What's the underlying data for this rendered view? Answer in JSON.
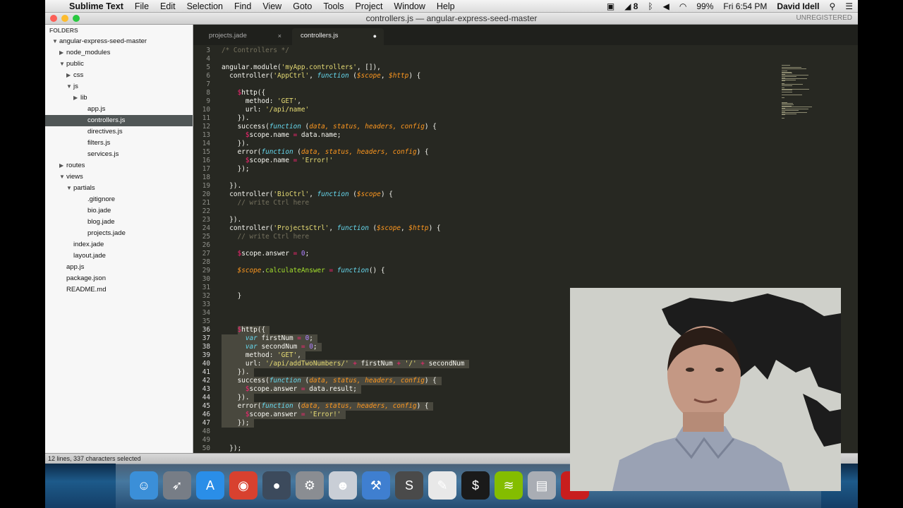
{
  "menubar": {
    "app": "Sublime Text",
    "items": [
      "File",
      "Edit",
      "Selection",
      "Find",
      "View",
      "Goto",
      "Tools",
      "Project",
      "Window",
      "Help"
    ],
    "battery": "99%",
    "clock": "Fri 6:54 PM",
    "user": "David Idell",
    "notif_count": "8"
  },
  "window": {
    "title": "controllers.js — angular-express-seed-master",
    "unregistered": "UNREGISTERED"
  },
  "sidebar": {
    "header": "FOLDERS",
    "tree": [
      {
        "label": "angular-express-seed-master",
        "depth": 0,
        "open": true
      },
      {
        "label": "node_modules",
        "depth": 1,
        "folder": true,
        "open": false
      },
      {
        "label": "public",
        "depth": 1,
        "folder": true,
        "open": true
      },
      {
        "label": "css",
        "depth": 2,
        "folder": true,
        "open": false
      },
      {
        "label": "js",
        "depth": 2,
        "folder": true,
        "open": true
      },
      {
        "label": "lib",
        "depth": 3,
        "folder": true,
        "open": false
      },
      {
        "label": "app.js",
        "depth": 3
      },
      {
        "label": "controllers.js",
        "depth": 3,
        "selected": true
      },
      {
        "label": "directives.js",
        "depth": 3
      },
      {
        "label": "filters.js",
        "depth": 3
      },
      {
        "label": "services.js",
        "depth": 3
      },
      {
        "label": "routes",
        "depth": 1,
        "folder": true,
        "open": false
      },
      {
        "label": "views",
        "depth": 1,
        "folder": true,
        "open": true
      },
      {
        "label": "partials",
        "depth": 2,
        "folder": true,
        "open": true
      },
      {
        "label": ".gitignore",
        "depth": 3
      },
      {
        "label": "bio.jade",
        "depth": 3
      },
      {
        "label": "blog.jade",
        "depth": 3
      },
      {
        "label": "projects.jade",
        "depth": 3
      },
      {
        "label": "index.jade",
        "depth": 2
      },
      {
        "label": "layout.jade",
        "depth": 2
      },
      {
        "label": "app.js",
        "depth": 1
      },
      {
        "label": "package.json",
        "depth": 1
      },
      {
        "label": "README.md",
        "depth": 1
      }
    ]
  },
  "tabs": [
    {
      "label": "projects.jade",
      "active": false,
      "close": "×"
    },
    {
      "label": "controllers.js",
      "active": true,
      "close": "●"
    }
  ],
  "code": [
    {
      "n": 3,
      "t": [
        [
          "c",
          "/* Controllers */"
        ]
      ]
    },
    {
      "n": 4,
      "t": []
    },
    {
      "n": 5,
      "t": [
        [
          "",
          "angular.module("
        ],
        [
          "s",
          "'myApp.controllers'"
        ],
        [
          "",
          ", []),"
        ]
      ]
    },
    {
      "n": 6,
      "t": [
        [
          "",
          "  controller("
        ],
        [
          "s",
          "'AppCtrl'"
        ],
        [
          "",
          ", "
        ],
        [
          "i",
          "function"
        ],
        [
          "",
          " ("
        ],
        [
          "v",
          "$scope"
        ],
        [
          "",
          ", "
        ],
        [
          "v",
          "$http"
        ],
        [
          "",
          ") {"
        ]
      ]
    },
    {
      "n": 7,
      "t": []
    },
    {
      "n": 8,
      "t": [
        [
          "",
          "    "
        ],
        [
          "k",
          "$"
        ],
        [
          "",
          "http({"
        ]
      ]
    },
    {
      "n": 9,
      "t": [
        [
          "",
          "      method: "
        ],
        [
          "s",
          "'GET'"
        ],
        [
          "",
          ","
        ]
      ]
    },
    {
      "n": 10,
      "t": [
        [
          "",
          "      url: "
        ],
        [
          "s",
          "'/api/name'"
        ]
      ]
    },
    {
      "n": 11,
      "t": [
        [
          "",
          "    })."
        ]
      ]
    },
    {
      "n": 12,
      "t": [
        [
          "",
          "    success("
        ],
        [
          "i",
          "function"
        ],
        [
          "",
          " ("
        ],
        [
          "v",
          "data, status, headers, config"
        ],
        [
          "",
          ") {"
        ]
      ]
    },
    {
      "n": 13,
      "t": [
        [
          "",
          "      "
        ],
        [
          "k",
          "$"
        ],
        [
          "",
          "scope.name "
        ],
        [
          "k",
          "="
        ],
        [
          "",
          " data.name;"
        ]
      ]
    },
    {
      "n": 14,
      "t": [
        [
          "",
          "    })."
        ]
      ]
    },
    {
      "n": 15,
      "t": [
        [
          "",
          "    error("
        ],
        [
          "i",
          "function"
        ],
        [
          "",
          " ("
        ],
        [
          "v",
          "data, status, headers, config"
        ],
        [
          "",
          ") {"
        ]
      ]
    },
    {
      "n": 16,
      "t": [
        [
          "",
          "      "
        ],
        [
          "k",
          "$"
        ],
        [
          "",
          "scope.name "
        ],
        [
          "k",
          "="
        ],
        [
          "",
          " "
        ],
        [
          "s",
          "'Error!'"
        ]
      ]
    },
    {
      "n": 17,
      "t": [
        [
          "",
          "    });"
        ]
      ]
    },
    {
      "n": 18,
      "t": []
    },
    {
      "n": 19,
      "t": [
        [
          "",
          "  })."
        ]
      ]
    },
    {
      "n": 20,
      "t": [
        [
          "",
          "  controller("
        ],
        [
          "s",
          "'BioCtrl'"
        ],
        [
          "",
          ", "
        ],
        [
          "i",
          "function"
        ],
        [
          "",
          " ("
        ],
        [
          "v",
          "$scope"
        ],
        [
          "",
          ") {"
        ]
      ]
    },
    {
      "n": 21,
      "t": [
        [
          "c",
          "    // write Ctrl here"
        ]
      ]
    },
    {
      "n": 22,
      "t": []
    },
    {
      "n": 23,
      "t": [
        [
          "",
          "  })."
        ]
      ]
    },
    {
      "n": 24,
      "t": [
        [
          "",
          "  controller("
        ],
        [
          "s",
          "'ProjectsCtrl'"
        ],
        [
          "",
          ", "
        ],
        [
          "i",
          "function"
        ],
        [
          "",
          " ("
        ],
        [
          "v",
          "$scope"
        ],
        [
          "",
          ", "
        ],
        [
          "v",
          "$http"
        ],
        [
          "",
          ") {"
        ]
      ]
    },
    {
      "n": 25,
      "t": [
        [
          "c",
          "    // write Ctrl here"
        ]
      ]
    },
    {
      "n": 26,
      "t": []
    },
    {
      "n": 27,
      "t": [
        [
          "",
          "    "
        ],
        [
          "k",
          "$"
        ],
        [
          "",
          "scope.answer "
        ],
        [
          "k",
          "="
        ],
        [
          "",
          " "
        ],
        [
          "n",
          "0"
        ],
        [
          "",
          ";"
        ]
      ]
    },
    {
      "n": 28,
      "t": []
    },
    {
      "n": 29,
      "t": [
        [
          "",
          "    "
        ],
        [
          "v",
          "$scope"
        ],
        [
          "",
          "."
        ],
        [
          "f",
          "calculateAnswer"
        ],
        [
          "",
          " "
        ],
        [
          "k",
          "="
        ],
        [
          "",
          " "
        ],
        [
          "i",
          "function"
        ],
        [
          "",
          "() {"
        ]
      ]
    },
    {
      "n": 30,
      "t": []
    },
    {
      "n": 31,
      "t": []
    },
    {
      "n": 32,
      "t": [
        [
          "",
          "    }"
        ]
      ]
    },
    {
      "n": 33,
      "t": []
    },
    {
      "n": 34,
      "t": []
    },
    {
      "n": 35,
      "t": []
    },
    {
      "n": 36,
      "t": [
        [
          "",
          "    "
        ],
        [
          "k",
          "$"
        ],
        [
          "",
          "http({"
        ]
      ]
    },
    {
      "n": 37,
      "t": [
        [
          "",
          "      "
        ],
        [
          "i",
          "var"
        ],
        [
          "",
          " firstNum "
        ],
        [
          "k",
          "="
        ],
        [
          "",
          " "
        ],
        [
          "n",
          "0"
        ],
        [
          "",
          ";"
        ]
      ]
    },
    {
      "n": 38,
      "t": [
        [
          "",
          "      "
        ],
        [
          "i",
          "var"
        ],
        [
          "",
          " secondNum "
        ],
        [
          "k",
          "="
        ],
        [
          "",
          " "
        ],
        [
          "n",
          "0"
        ],
        [
          "",
          ";"
        ]
      ]
    },
    {
      "n": 39,
      "t": [
        [
          "",
          "      method: "
        ],
        [
          "s",
          "'GET'"
        ],
        [
          "",
          ","
        ]
      ]
    },
    {
      "n": 40,
      "t": [
        [
          "",
          "      url: "
        ],
        [
          "s",
          "'/api/addTwoNumbers/'"
        ],
        [
          "",
          " "
        ],
        [
          "k",
          "+"
        ],
        [
          "",
          " firstNum "
        ],
        [
          "k",
          "+"
        ],
        [
          "",
          " "
        ],
        [
          "s",
          "'/'"
        ],
        [
          "",
          " "
        ],
        [
          "k",
          "+"
        ],
        [
          "",
          " secondNum"
        ]
      ]
    },
    {
      "n": 41,
      "t": [
        [
          "",
          "    })."
        ]
      ]
    },
    {
      "n": 42,
      "t": [
        [
          "",
          "    success("
        ],
        [
          "i",
          "function"
        ],
        [
          "",
          " ("
        ],
        [
          "v",
          "data, status, headers, config"
        ],
        [
          "",
          ") {"
        ]
      ]
    },
    {
      "n": 43,
      "t": [
        [
          "",
          "      "
        ],
        [
          "k",
          "$"
        ],
        [
          "",
          "scope.answer "
        ],
        [
          "k",
          "="
        ],
        [
          "",
          " data.result;"
        ]
      ]
    },
    {
      "n": 44,
      "t": [
        [
          "",
          "    })."
        ]
      ]
    },
    {
      "n": 45,
      "t": [
        [
          "",
          "    error("
        ],
        [
          "i",
          "function"
        ],
        [
          "",
          " ("
        ],
        [
          "v",
          "data, status, headers, config"
        ],
        [
          "",
          ") {"
        ]
      ]
    },
    {
      "n": 46,
      "t": [
        [
          "",
          "      "
        ],
        [
          "k",
          "$"
        ],
        [
          "",
          "scope.answer "
        ],
        [
          "k",
          "="
        ],
        [
          "",
          " "
        ],
        [
          "s",
          "'Error!'"
        ]
      ]
    },
    {
      "n": 47,
      "t": [
        [
          "",
          "    });"
        ]
      ]
    },
    {
      "n": 48,
      "t": []
    },
    {
      "n": 49,
      "t": []
    },
    {
      "n": 50,
      "t": [
        [
          "",
          "  });"
        ]
      ]
    }
  ],
  "selection": {
    "from": 36,
    "to": 47
  },
  "status": "12 lines, 337 characters selected",
  "dock": [
    {
      "name": "finder-icon",
      "glyph": "☺",
      "color": "#3b8fd8"
    },
    {
      "name": "launchpad-icon",
      "glyph": "➶",
      "color": "#777d86"
    },
    {
      "name": "app-store-icon",
      "glyph": "A",
      "color": "#2a8ee8"
    },
    {
      "name": "chrome-icon",
      "glyph": "◉",
      "color": "#d8412f"
    },
    {
      "name": "webcam-app-icon",
      "glyph": "●",
      "color": "#3c4a5c"
    },
    {
      "name": "system-preferences-icon",
      "glyph": "⚙",
      "color": "#8a8d92"
    },
    {
      "name": "developer-app-icon",
      "glyph": "☻",
      "color": "#c9ced6"
    },
    {
      "name": "xcode-icon",
      "glyph": "⚒",
      "color": "#3f7fd0"
    },
    {
      "name": "sublime-text-icon",
      "glyph": "S",
      "color": "#4a4a4a"
    },
    {
      "name": "evernote-icon",
      "glyph": "✎",
      "color": "#e8e8e8"
    },
    {
      "name": "terminal-icon",
      "glyph": "$",
      "color": "#1a1a1a"
    },
    {
      "name": "spotify-icon",
      "glyph": "≋",
      "color": "#84bd00"
    },
    {
      "name": "database-icon",
      "glyph": "▤",
      "color": "#a9adb4"
    },
    {
      "name": "red-app-icon",
      "glyph": "A",
      "color": "#c81e1e"
    }
  ]
}
